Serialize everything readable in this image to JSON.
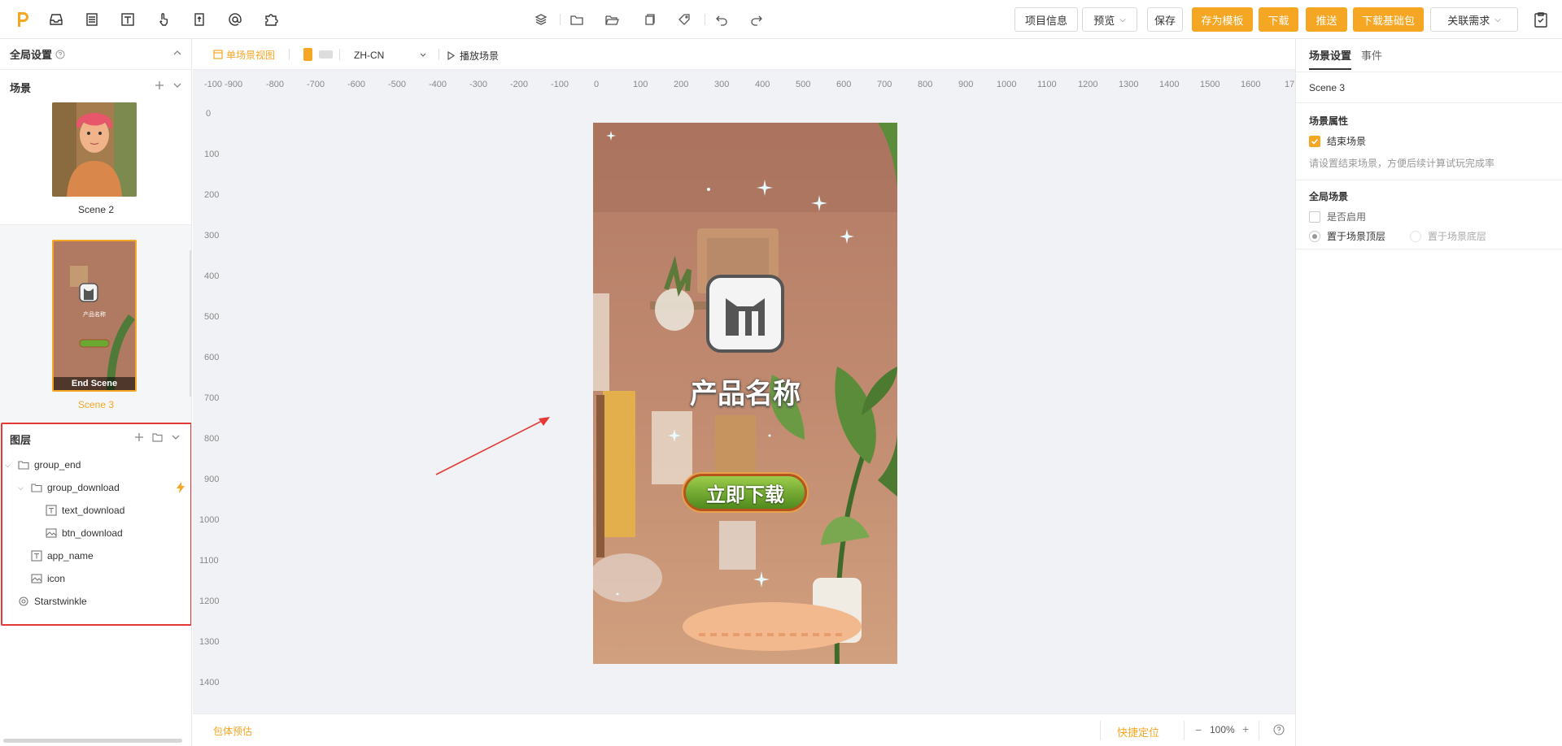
{
  "toolbar": {
    "project_info": "项目信息",
    "preview": "预览",
    "save": "保存",
    "save_template": "存为模板",
    "download": "下载",
    "push": "推送",
    "download_base": "下载基础包",
    "linked_req": "关联需求",
    "left_icons": [
      "inbox-icon",
      "page-icon",
      "text-tool-icon",
      "hand-pointer-icon",
      "document-upload-icon",
      "at-sign-icon",
      "puzzle-icon"
    ],
    "center_icons": [
      "layers-icon",
      "folder-icon",
      "folder-open-icon",
      "copy-icon",
      "tag-icon",
      "undo-icon",
      "redo-icon"
    ]
  },
  "left": {
    "global_settings": "全局设置",
    "scenes_title": "场景",
    "scenes": [
      {
        "label": "Scene 2",
        "active": false
      },
      {
        "label": "Scene 3",
        "active": true,
        "overlay": "End Scene"
      }
    ],
    "layers_title": "图层",
    "layers": [
      {
        "name": "group_end",
        "type": "folder",
        "depth": 0,
        "expanded": true
      },
      {
        "name": "group_download",
        "type": "folder",
        "depth": 1,
        "expanded": true,
        "flag": "lightning-icon"
      },
      {
        "name": "text_download",
        "type": "text",
        "depth": 2
      },
      {
        "name": "btn_download",
        "type": "image",
        "depth": 2
      },
      {
        "name": "app_name",
        "type": "text",
        "depth": 1
      },
      {
        "name": "icon",
        "type": "image",
        "depth": 1
      },
      {
        "name": "Starstwinkle",
        "type": "effect",
        "depth": 0
      }
    ]
  },
  "canvas": {
    "view_mode": "单场景视图",
    "language": "ZH-CN",
    "play_scene": "播放场景",
    "ruler_top": [
      "-100 -900",
      "-800",
      "-700",
      "-600",
      "-500",
      "-400",
      "-300",
      "-200",
      "-100",
      "0",
      "100",
      "200",
      "300",
      "400",
      "500",
      "600",
      "700",
      "800",
      "900",
      "1000",
      "1100",
      "1200",
      "1300",
      "1400",
      "1500",
      "1600",
      "17"
    ],
    "ruler_left": [
      "0",
      "100",
      "200",
      "300",
      "400",
      "500",
      "600",
      "700",
      "800",
      "900",
      "1000",
      "1100",
      "1200",
      "1300",
      "1400"
    ],
    "phone": {
      "app_name": "产品名称",
      "button": "立即下载"
    },
    "bottom": {
      "preview_size": "包体预估",
      "quick_locate": "快捷定位",
      "zoom": "100%"
    }
  },
  "right": {
    "tabs": [
      {
        "label": "场景设置",
        "active": true
      },
      {
        "label": "事件",
        "active": false
      }
    ],
    "scene_name": "Scene 3",
    "scene_props_title": "场景属性",
    "end_scene_label": "结束场景",
    "end_scene_checked": true,
    "end_scene_hint": "请设置结束场景，方便后续计算试玩完成率",
    "global_scene_title": "全局场景",
    "enable_label": "是否启用",
    "enable_checked": false,
    "top_label": "置于场景顶层",
    "bottom_label": "置于场景底层"
  },
  "colors": {
    "accent": "#f5a623",
    "highlight_box": "#e53935",
    "arrow": "#e53935"
  }
}
